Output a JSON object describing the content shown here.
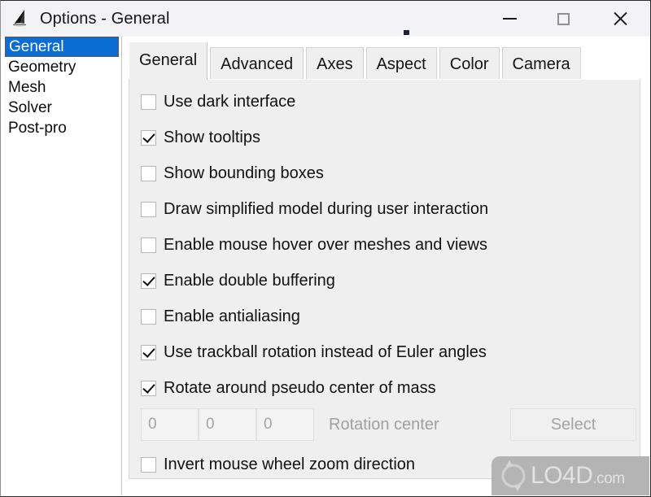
{
  "window": {
    "title": "Options - General",
    "icon": "gmsh-cone-icon",
    "controls": {
      "minimize": "minimize-icon",
      "maximize": "maximize-icon",
      "close": "close-icon"
    }
  },
  "sidebar": {
    "items": [
      {
        "label": "General",
        "selected": true
      },
      {
        "label": "Geometry",
        "selected": false
      },
      {
        "label": "Mesh",
        "selected": false
      },
      {
        "label": "Solver",
        "selected": false
      },
      {
        "label": "Post-pro",
        "selected": false
      }
    ]
  },
  "tabs": [
    {
      "label": "General",
      "active": true
    },
    {
      "label": "Advanced",
      "active": false
    },
    {
      "label": "Axes",
      "active": false
    },
    {
      "label": "Aspect",
      "active": false
    },
    {
      "label": "Color",
      "active": false
    },
    {
      "label": "Camera",
      "active": false
    }
  ],
  "options": [
    {
      "label": "Use dark interface",
      "checked": false
    },
    {
      "label": "Show tooltips",
      "checked": true
    },
    {
      "label": "Show bounding boxes",
      "checked": false
    },
    {
      "label": "Draw simplified model during user interaction",
      "checked": false
    },
    {
      "label": "Enable mouse hover over meshes and views",
      "checked": false
    },
    {
      "label": "Enable double buffering",
      "checked": true
    },
    {
      "label": "Enable antialiasing",
      "checked": false
    },
    {
      "label": "Use trackball rotation instead of Euler angles",
      "checked": true
    },
    {
      "label": "Rotate around pseudo center of mass",
      "checked": true
    }
  ],
  "rotation_center": {
    "x": "0",
    "y": "0",
    "z": "0",
    "label": "Rotation center",
    "select_button": "Select",
    "disabled": true
  },
  "invert_zoom": {
    "label": "Invert mouse wheel zoom direction",
    "checked": false
  },
  "watermark": {
    "name": "LO4D",
    "suffix": ".com",
    "icon": "refresh-circle-icon"
  },
  "colors": {
    "selection_blue": "#0a6dd4",
    "panel_bg": "#efefef",
    "titlebar_bg": "#f3f3f6",
    "text": "#111111",
    "disabled_text": "#a3a3a3",
    "watermark_bg": "#b4b4b4"
  }
}
